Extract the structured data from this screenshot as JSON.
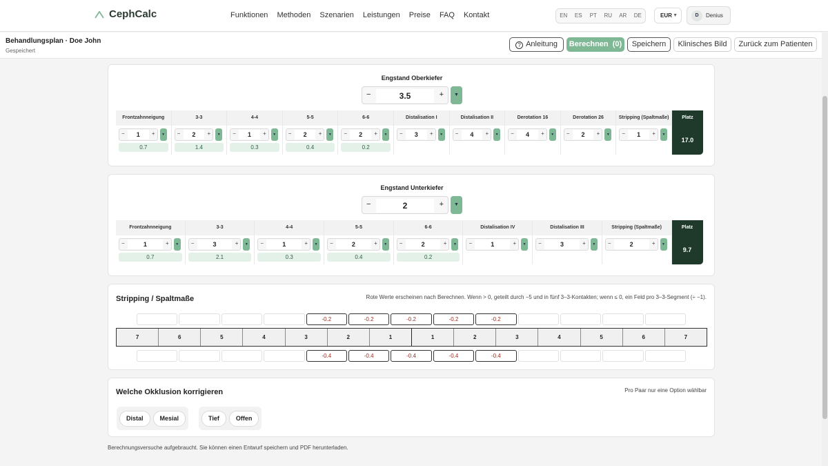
{
  "brand": {
    "name": "CephCalc"
  },
  "nav": [
    "Funktionen",
    "Methoden",
    "Szenarien",
    "Leistungen",
    "Preise",
    "FAQ",
    "Kontakt"
  ],
  "languages": [
    "EN",
    "ES",
    "PT",
    "RU",
    "AR",
    "DE"
  ],
  "currency": "EUR",
  "user": {
    "initial": "D",
    "name": "Denius"
  },
  "header": {
    "title": "Behandlungsplan · Doe John",
    "status": "Gespeichert",
    "buttons": {
      "help": "Anleitung",
      "calc": "Berechnen  (0)",
      "save": "Speichern",
      "clinical": "Klinisches Bild",
      "back": "Zurück zum Patienten"
    }
  },
  "upper": {
    "title": "Engstand Oberkiefer",
    "value": "3.5",
    "platz_label": "Platz",
    "platz_value": "17.0",
    "columns": [
      {
        "label": "Frontzahnneigung",
        "value": "1",
        "sub": "0.7"
      },
      {
        "label": "3-3",
        "value": "2",
        "sub": "1.4"
      },
      {
        "label": "4-4",
        "value": "1",
        "sub": "0.3"
      },
      {
        "label": "5-5",
        "value": "2",
        "sub": "0.4"
      },
      {
        "label": "6-6",
        "value": "2",
        "sub": "0.2"
      },
      {
        "label": "Distalisation I",
        "value": "3",
        "sub": ""
      },
      {
        "label": "Distalisation II",
        "value": "4",
        "sub": ""
      },
      {
        "label": "Derotation 16",
        "value": "4",
        "sub": ""
      },
      {
        "label": "Derotation 26",
        "value": "2",
        "sub": ""
      },
      {
        "label": "Stripping (Spaltmaße)",
        "value": "1",
        "sub": ""
      }
    ]
  },
  "lower": {
    "title": "Engstand Unterkiefer",
    "value": "2",
    "platz_label": "Platz",
    "platz_value": "9.7",
    "columns": [
      {
        "label": "Frontzahnneigung",
        "value": "1",
        "sub": "0.7"
      },
      {
        "label": "3-3",
        "value": "3",
        "sub": "2.1"
      },
      {
        "label": "4-4",
        "value": "1",
        "sub": "0.3"
      },
      {
        "label": "5-5",
        "value": "2",
        "sub": "0.4"
      },
      {
        "label": "6-6",
        "value": "2",
        "sub": "0.2"
      },
      {
        "label": "Distalisation IV",
        "value": "1",
        "sub": ""
      },
      {
        "label": "Distalisation III",
        "value": "3",
        "sub": ""
      },
      {
        "label": "Stripping (Spaltmaße)",
        "value": "2",
        "sub": ""
      }
    ]
  },
  "stripping": {
    "title": "Stripping / Spaltmaße",
    "note": "Rote Werte erscheinen nach Berechnen. Wenn > 0, geteilt durch −5 und in fünf 3–3-Kontakten; wenn ≤ 0, ein Feld pro 3–3-Segment (÷ −1).",
    "upper_gaps": [
      "",
      "",
      "",
      "",
      "-0.2",
      "-0.2",
      "-0.2",
      "-0.2",
      "-0.2",
      "",
      "",
      "",
      ""
    ],
    "teeth": [
      "7",
      "6",
      "5",
      "4",
      "3",
      "2",
      "1",
      "1",
      "2",
      "3",
      "4",
      "5",
      "6",
      "7"
    ],
    "lower_gaps": [
      "",
      "",
      "",
      "",
      "-0.4",
      "-0.4",
      "-0.4",
      "-0.4",
      "-0.4",
      "",
      "",
      "",
      ""
    ]
  },
  "occlusion": {
    "title": "Welche Okklusion korrigieren",
    "note": "Pro Paar nur eine Option wählbar",
    "groups": [
      [
        "Distal",
        "Mesial"
      ],
      [
        "Tief",
        "Offen"
      ]
    ]
  },
  "footer_note": "Berechnungsversuche aufgebraucht. Sie können einen Entwurf speichern und PDF herunterladen."
}
